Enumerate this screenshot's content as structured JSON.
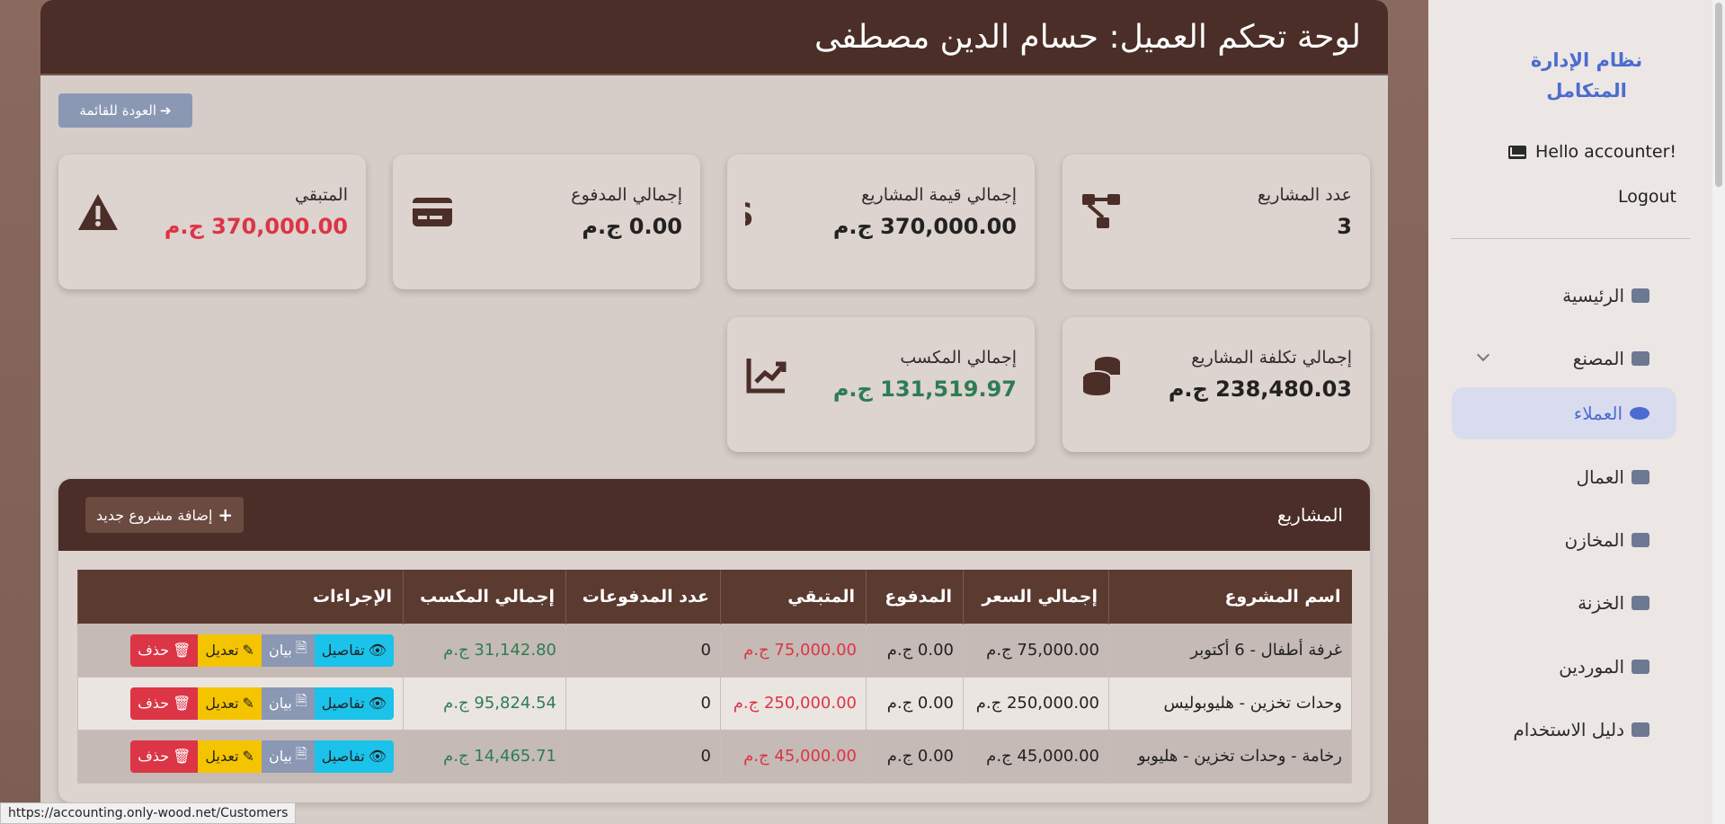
{
  "sidebar": {
    "brand": "نظام الإدارة المتكامل",
    "greeting": "Hello accounter!",
    "logout": "Logout",
    "items": [
      {
        "label": "الرئيسية",
        "icon": "home-icon"
      },
      {
        "label": "المصنع",
        "icon": "factory-icon"
      },
      {
        "label": "العملاء",
        "icon": "users-icon"
      },
      {
        "label": "العمال",
        "icon": "hardhat-icon"
      },
      {
        "label": "المخازن",
        "icon": "warehouse-icon"
      },
      {
        "label": "الخزنة",
        "icon": "cash-register-icon"
      },
      {
        "label": "الموردين",
        "icon": "dolly-icon"
      },
      {
        "label": "دليل الاستخدام",
        "icon": "book-icon"
      }
    ]
  },
  "header": {
    "title": "لوحة تحكم العميل: حسام الدين مصطفى"
  },
  "back_button": "العودة للقائمة",
  "cards": {
    "projects_count": {
      "label": "عدد المشاريع",
      "value": "3"
    },
    "projects_value": {
      "label": "إجمالي قيمة المشاريع",
      "value": "370,000.00 ج.م"
    },
    "paid": {
      "label": "إجمالي المدفوع",
      "value": "0.00 ج.م"
    },
    "remaining": {
      "label": "المتبقي",
      "value": "370,000.00 ج.م"
    },
    "cost": {
      "label": "إجمالي تكلفة المشاريع",
      "value": "238,480.03 ج.م"
    },
    "profit": {
      "label": "إجمالي المكسب",
      "value": "131,519.97 ج.م"
    }
  },
  "projects": {
    "title": "المشاريع",
    "add_button": "إضافة مشروع جديد",
    "columns": [
      "اسم المشروع",
      "إجمالي السعر",
      "المدفوع",
      "المتبقي",
      "عدد المدفوعات",
      "إجمالي المكسب",
      "الإجراءات"
    ],
    "rows": [
      {
        "name": "غرفة أطفال - 6 أكتوبر",
        "price": "75,000.00 ج.م",
        "paid": "0.00 ج.م",
        "remaining": "75,000.00 ج.م",
        "payments": "0",
        "profit": "31,142.80 ج.م"
      },
      {
        "name": "وحدات تخزين - هليوبوليس",
        "price": "250,000.00 ج.م",
        "paid": "0.00 ج.م",
        "remaining": "250,000.00 ج.م",
        "payments": "0",
        "profit": "95,824.54 ج.م"
      },
      {
        "name": "رخامة - وحدات تخزين - هليوبو",
        "price": "45,000.00 ج.م",
        "paid": "0.00 ج.م",
        "remaining": "45,000.00 ج.م",
        "payments": "0",
        "profit": "14,465.71 ج.م"
      }
    ],
    "actions": {
      "details": "تفاصيل",
      "view": "بيان",
      "edit": "تعديل",
      "delete": "حذف"
    }
  },
  "status_url": "https://accounting.only-wood.net/Customers"
}
